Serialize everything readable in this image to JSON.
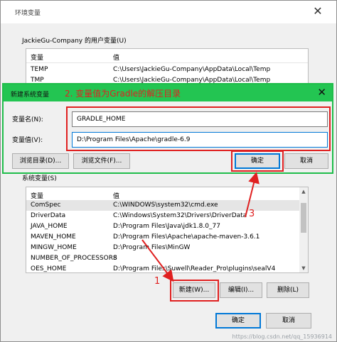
{
  "window": {
    "title": "环境变量",
    "close_glyph": "✕"
  },
  "user_vars": {
    "label": "JackieGu-Company 的用户变量(U)",
    "col_name": "变量",
    "col_value": "值",
    "rows": [
      {
        "name": "TEMP",
        "value": "C:\\Users\\JackieGu-Company\\AppData\\Local\\Temp"
      },
      {
        "name": "TMP",
        "value": "C:\\Users\\JackieGu-Company\\AppData\\Local\\Temp"
      }
    ]
  },
  "dialog": {
    "title": "新建系统变量",
    "annotation": "2. 变量值为Gradle的解压目录",
    "close_glyph": "✕",
    "name_label": "变量名(N):",
    "name_value": "GRADLE_HOME",
    "value_label": "变量值(V):",
    "value_value": "D:\\Program Files\\Apache\\gradle-6.9",
    "browse_dir": "浏览目录(D)...",
    "browse_file": "浏览文件(F)...",
    "ok": "确定",
    "cancel": "取消"
  },
  "sys_vars": {
    "label": "系统变量(S)",
    "col_name": "变量",
    "col_value": "值",
    "rows": [
      {
        "name": "ComSpec",
        "value": "C:\\WINDOWS\\system32\\cmd.exe"
      },
      {
        "name": "DriverData",
        "value": "C:\\Windows\\System32\\Drivers\\DriverData"
      },
      {
        "name": "JAVA_HOME",
        "value": "D:\\Program Files\\Java\\jdk1.8.0_77"
      },
      {
        "name": "MAVEN_HOME",
        "value": "D:\\Program Files\\Apache\\apache-maven-3.6.1"
      },
      {
        "name": "MINGW_HOME",
        "value": "D:\\Program Files\\MinGW"
      },
      {
        "name": "NUMBER_OF_PROCESSORS",
        "value": "8"
      },
      {
        "name": "OES_HOME",
        "value": "D:\\Program Files\\Suwell\\Reader_Pro\\plugins\\sealV4"
      }
    ],
    "new_btn": "新建(W)...",
    "edit_btn": "编辑(I)...",
    "delete_btn": "删除(L)"
  },
  "footer": {
    "ok": "确定",
    "cancel": "取消"
  },
  "annotations": {
    "n1": "1",
    "n3": "3",
    "watermark": "https://blog.csdn.net/qq_15936914",
    "color": "#e02020"
  }
}
